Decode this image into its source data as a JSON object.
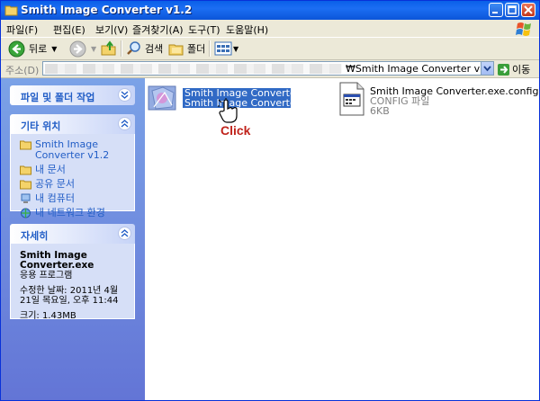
{
  "window": {
    "title": "Smith Image Converter v1.2"
  },
  "menu": [
    "파일(F)",
    "편집(E)",
    "보기(V)",
    "즐겨찾기(A)",
    "도구(T)",
    "도움말(H)"
  ],
  "toolbar": {
    "back_label": "뒤로",
    "search_label": "검색",
    "folder_label": "폴더"
  },
  "address": {
    "label": "주소(D)",
    "value": "₩Smith Image Converter v1.2",
    "go_label": "이동"
  },
  "left_panels": {
    "tasks": {
      "title": "파일 및 폴더 작업"
    },
    "other_places": {
      "title": "기타 위치",
      "items": [
        {
          "label": "Smith Image Converter v1.2",
          "icon": "folder-icon"
        },
        {
          "label": "내 문서",
          "icon": "folder-icon"
        },
        {
          "label": "공유 문서",
          "icon": "folder-icon"
        },
        {
          "label": "내 컴퓨터",
          "icon": "computer-icon"
        },
        {
          "label": "내 네트워크 환경",
          "icon": "network-icon"
        }
      ]
    },
    "details": {
      "title": "자세히",
      "name": "Smith Image Converter.exe",
      "type": "응용 프로그램",
      "modified": "수정한 날짜: 2011년 4월 21일 목요일, 오후 11:44",
      "size": "크기: 1.43MB"
    }
  },
  "files": [
    {
      "name1": "Smith Image Converter.exe",
      "name2": "Smith Image Converter",
      "selected": true
    },
    {
      "name1": "Smith Image Converter.exe.config",
      "type": "CONFIG 파일",
      "size": "6KB"
    }
  ],
  "annotation": {
    "click": "Click"
  },
  "colors": {
    "title_blue": "#0a5fe8",
    "link_blue": "#215dc6",
    "selection": "#316ac5",
    "click_red": "#c0231b"
  }
}
